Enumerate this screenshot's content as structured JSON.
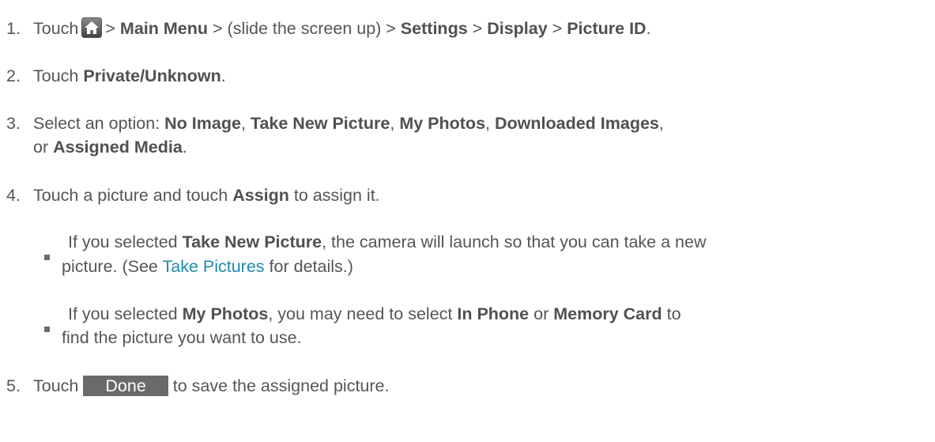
{
  "steps": [
    {
      "num": "1.",
      "t1": "Touch",
      "t2": ">",
      "b1": "Main Menu",
      "t3": "> (slide the screen up) >",
      "b2": "Settings",
      "t4": ">",
      "b3": "Display",
      "t5": ">",
      "b4": "Picture ID",
      "t6": "."
    },
    {
      "num": "2.",
      "t1": "Touch",
      "b1": "Private/Unknown",
      "t2": "."
    },
    {
      "num": "3.",
      "t1": "Select an option:",
      "b1": "No Image",
      "t2": ",",
      "b2": "Take New Picture",
      "t3": ",",
      "b3": "My Photos",
      "t4": ",",
      "b4": "Downloaded Images",
      "t5": ",",
      "t6": "or",
      "b5": "Assigned Media",
      "t7": "."
    },
    {
      "num": "4.",
      "t1": "Touch a picture and touch",
      "b1": "Assign",
      "t2": "to assign it."
    },
    {
      "num": "5.",
      "t1": "Touch",
      "button": "Done",
      "t2": "to save the assigned picture."
    }
  ],
  "bullets": [
    {
      "t1": "If you selected",
      "b1": "Take New Picture",
      "t2": ", the camera will launch so that you can take a new",
      "t3": "picture. (See",
      "link": "Take Pictures",
      "t4": "for details.)"
    },
    {
      "t1": "If you selected",
      "b1": "My Photos",
      "t2": ", you may need to select",
      "b2": "In Phone",
      "t3": "or",
      "b3": "Memory Card",
      "t4": "to",
      "t5": "find the picture you want to use."
    }
  ],
  "icons": {
    "home": "home-icon"
  },
  "colors": {
    "text": "#555555",
    "link": "#1f8ab0",
    "button_bg": "#6a6a6a"
  }
}
